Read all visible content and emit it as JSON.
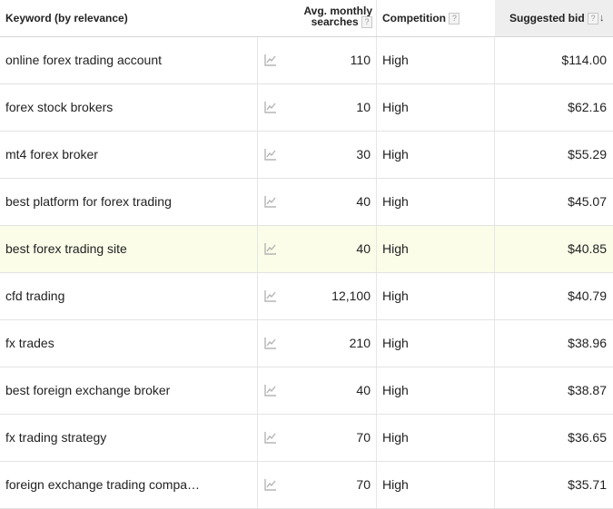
{
  "header": {
    "keyword": "Keyword (by relevance)",
    "avg_line1": "Avg. monthly",
    "avg_line2": "searches",
    "competition": "Competition",
    "suggested_bid": "Suggested bid",
    "help_glyph": "?",
    "sort_glyph": "↓"
  },
  "rows": [
    {
      "keyword": "online forex trading account",
      "searches": "110",
      "competition": "High",
      "bid": "$114.00"
    },
    {
      "keyword": "forex stock brokers",
      "searches": "10",
      "competition": "High",
      "bid": "$62.16"
    },
    {
      "keyword": "mt4 forex broker",
      "searches": "30",
      "competition": "High",
      "bid": "$55.29"
    },
    {
      "keyword": "best platform for forex trading",
      "searches": "40",
      "competition": "High",
      "bid": "$45.07"
    },
    {
      "keyword": "best forex trading site",
      "searches": "40",
      "competition": "High",
      "bid": "$40.85"
    },
    {
      "keyword": "cfd trading",
      "searches": "12,100",
      "competition": "High",
      "bid": "$40.79"
    },
    {
      "keyword": "fx trades",
      "searches": "210",
      "competition": "High",
      "bid": "$38.96"
    },
    {
      "keyword": "best foreign exchange broker",
      "searches": "40",
      "competition": "High",
      "bid": "$38.87"
    },
    {
      "keyword": "fx trading strategy",
      "searches": "70",
      "competition": "High",
      "bid": "$36.65"
    },
    {
      "keyword": "foreign exchange trading compa…",
      "searches": "70",
      "competition": "High",
      "bid": "$35.71"
    }
  ],
  "colors": {
    "highlight_row": "#fbfde8",
    "header_sorted_bg": "#eeeeee",
    "trend_icon": "#b5b5b5"
  },
  "icons": {
    "trend": "trend-chart-icon",
    "help": "help-icon",
    "sort": "sort-descending-icon"
  }
}
